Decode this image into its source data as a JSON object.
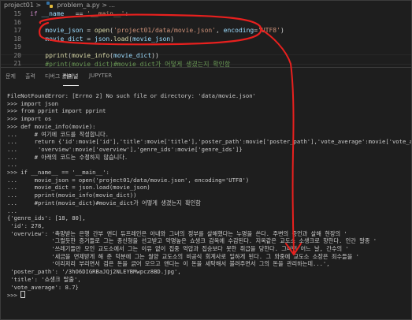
{
  "breadcrumb": {
    "folder": "project01",
    "sep": ">",
    "file": "problem_a.py",
    "more": "> ..."
  },
  "editor": {
    "lines": [
      {
        "num": "15",
        "parts": [
          [
            "kw",
            "if "
          ],
          [
            "var",
            "__name__"
          ],
          [
            "op",
            " == "
          ],
          [
            "str",
            "'__main__'"
          ],
          [
            "op",
            ":"
          ]
        ]
      },
      {
        "num": "16",
        "parts": []
      },
      {
        "num": "17",
        "parts": [
          [
            "var",
            "    movie_json"
          ],
          [
            "op",
            " = "
          ],
          [
            "fn",
            "open"
          ],
          [
            "op",
            "("
          ],
          [
            "str",
            "'project01/data/movie.json'"
          ],
          [
            "op",
            ", "
          ],
          [
            "var",
            "encoding"
          ],
          [
            "op",
            "="
          ],
          [
            "str",
            "'UTF8'"
          ],
          [
            "op",
            ")"
          ]
        ]
      },
      {
        "num": "18",
        "parts": [
          [
            "var",
            "    movie_dict"
          ],
          [
            "op",
            " = "
          ],
          [
            "var",
            "json"
          ],
          [
            "op",
            "."
          ],
          [
            "fn",
            "load"
          ],
          [
            "op",
            "("
          ],
          [
            "var",
            "movie_json"
          ],
          [
            "op",
            ")"
          ]
        ]
      },
      {
        "num": "19",
        "parts": []
      },
      {
        "num": "20",
        "parts": [
          [
            "fn",
            "    pprint"
          ],
          [
            "op",
            "("
          ],
          [
            "fn",
            "movie_info"
          ],
          [
            "op",
            "("
          ],
          [
            "var",
            "movie_dict"
          ],
          [
            "op",
            "))"
          ]
        ]
      },
      {
        "num": "21",
        "parts": [
          [
            "cm",
            "    #print(movie_dict)#movie_dict가 어떻게 생겼는지 확인함"
          ]
        ]
      }
    ]
  },
  "panel_tabs": [
    "문제",
    "출력",
    "디버그 콘솔",
    "터미널",
    "JUPYTER"
  ],
  "active_tab": "터미널",
  "terminal_lines": [
    "FileNotFoundError: [Errno 2] No such file or directory: 'data/movie.json'",
    ">>> import json",
    ">>> from pprint import pprint",
    ">>> import os",
    ">>> def movie_info(movie):",
    "...     # 여기에 코드를 작성합니다.",
    "...     return {'id':movie['id'],'title':movie['title'],'poster_path':movie['poster_path'],'vote_average':movie['vote_average'],",
    "...      'overview':movie['overview'],'genre_ids':movie['genre_ids']}",
    "...     # 아래의 코드는 수정하지 않습니다.",
    "...",
    ">>> if __name__ == '__main__':",
    "...     movie_json = open('project01/data/movie.json', encoding='UTF8')",
    "...     movie_dict = json.load(movie_json)",
    "...     pprint(movie_info(movie_dict))",
    "...     #print(movie_dict)#movie_dict가 어떻게 생겼는지 확인함",
    "...",
    "{'genre_ids': [18, 80],",
    " 'id': 278,",
    " 'overview': '촉망받는 은행 간부 앤디 듀프레인은 아내와 그녀의 정부를 살해했다는 누명을 쓴다. 주변의 증언과 살해 현장의 '",
    "             '그럴듯한 증거들로 그는 종신형을 선고받고 악명높은 쇼생크 감옥에 수감된다. 지옥같은 교도소 소생크로 향한다. 인간 말종 '",
    "             '쓰레기들만 모인 교도소에서 그는 이유 없이 집중 억압과 집승보다 못한 취급을 당한다. 그러던 어느 날, 간수의 '",
    "             '세금을 면제받게 해 준 덕분에 그는 월양 교도소의 비공식 회계사로 일하게 된다. 그 와중에 교도소 소장은 죄수들을 '",
    "             '이리저리 부리면서 검은 돈을 긁어 모으고 앤디는 이 돈을 세탁해서 불려주면서 그의 돈을 관리하는데...',",
    " 'poster_path': '/3hO6DIGRBaJQj2NLEYBMwpcz8BD.jpg',",
    " 'title': '쇼생크 탈출',",
    " 'vote_average': 8.7}",
    ">>> "
  ]
}
